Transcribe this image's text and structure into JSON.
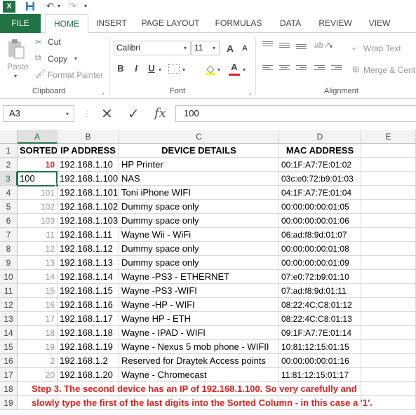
{
  "titlebar": {
    "logo": "X",
    "save": "💾",
    "undo": "↶",
    "redo": "↷"
  },
  "tabs": [
    "FILE",
    "HOME",
    "INSERT",
    "PAGE LAYOUT",
    "FORMULAS",
    "DATA",
    "REVIEW",
    "VIEW"
  ],
  "ribbon": {
    "clipboard": {
      "paste": "Paste",
      "cut": "Cut",
      "copy": "Copy",
      "format_painter": "Format Painter",
      "label": "Clipboard"
    },
    "font": {
      "name": "Calibri",
      "size": "11",
      "grow": "A",
      "shrink": "A",
      "bold": "B",
      "italic": "I",
      "underline": "U",
      "color": "A",
      "label": "Font"
    },
    "alignment": {
      "wrap": "Wrap Text",
      "merge": "Merge & Cent",
      "label": "Alignment"
    }
  },
  "formula_bar": {
    "name_box": "A3",
    "cancel": "✕",
    "enter": "✓",
    "fx": "fx",
    "content": "100"
  },
  "columns": [
    "A",
    "B",
    "C",
    "D",
    "E"
  ],
  "rows": [
    "1",
    "2",
    "3",
    "4",
    "5",
    "6",
    "7",
    "8",
    "9",
    "10",
    "11",
    "12",
    "13",
    "14",
    "15",
    "16",
    "17",
    "18",
    "19"
  ],
  "headers": {
    "sorted": "SORTED",
    "ip": "IP ADDRESS",
    "device": "DEVICE DETAILS",
    "mac": "MAC ADDRESS"
  },
  "data_rows": [
    {
      "sorted": "10",
      "ip": "192.168.1.10",
      "device": "HP  Printer",
      "mac": "00:1F:A7:7E:01:02"
    },
    {
      "sorted": "100",
      "ip": "192.168.1.100",
      "device": "NAS",
      "mac": "03c:e0:72:b9:01:03"
    },
    {
      "sorted": "101",
      "ip": "192.168.1.101",
      "device": "Toni iPhone WIFI",
      "mac": "04:1F:A7:7E:01:04"
    },
    {
      "sorted": "102",
      "ip": "192.168.1.102",
      "device": "Dummy space only",
      "mac": "00:00:00:00:01:05"
    },
    {
      "sorted": "103",
      "ip": "192.168.1.103",
      "device": "Dummy space only",
      "mac": "00:00:00:00:01:06"
    },
    {
      "sorted": "11",
      "ip": "192.168.1.11",
      "device": "Wayne Wii - WiFi",
      "mac": "06:ad:f8:9d:01:07"
    },
    {
      "sorted": "12",
      "ip": "192.168.1.12",
      "device": "Dummy space only",
      "mac": "00:00:00:00:01:08"
    },
    {
      "sorted": "13",
      "ip": "192.168.1.13",
      "device": "Dummy space only",
      "mac": "00:00:00:00:01:09"
    },
    {
      "sorted": "14",
      "ip": "192.168.1.14",
      "device": "Wayne -PS3 - ETHERNET",
      "mac": "07:e0:72:b9:01:10"
    },
    {
      "sorted": "15",
      "ip": "192.168.1.15",
      "device": "Wayne -PS3 -WIFI",
      "mac": "07:ad:f8:9d:01:11"
    },
    {
      "sorted": "16",
      "ip": "192.168.1.16",
      "device": "Wayne -HP - WIFI",
      "mac": "08:22:4C:C8:01:12"
    },
    {
      "sorted": "17",
      "ip": "192.168.1.17",
      "device": "Wayne  HP - ETH",
      "mac": "08:22:4C:C8:01:13"
    },
    {
      "sorted": "18",
      "ip": "192.168.1.18",
      "device": "Wayne - IPAD - WIFI",
      "mac": "09:1F:A7:7E:01:14"
    },
    {
      "sorted": "19",
      "ip": "192.168.1.19",
      "device": "Wayne - Nexus 5 mob phone - WIFII",
      "mac": "10:81:12:15:01:15"
    },
    {
      "sorted": "2",
      "ip": "192.168.1.2",
      "device": "Reserved for Draytek Access points",
      "mac": "00:00:00:00:01:16"
    },
    {
      "sorted": "20",
      "ip": "192.168.1.20",
      "device": "Wayne - Chromecast",
      "mac": "11:81:12:15:01:17"
    }
  ],
  "notes": [
    "Step 3. The second device has an IP of 192.168.1.100. So very carefully and",
    "slowly type the first of the last digits into the Sorted Column - in this case a '1'."
  ],
  "colors": {
    "excel_green": "#217346",
    "accent_red": "#e0201c"
  }
}
